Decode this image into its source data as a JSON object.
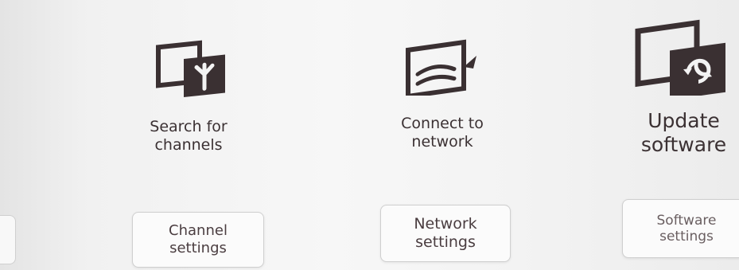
{
  "menu": {
    "items": [
      {
        "title_line1": "Search for",
        "title_line2": "channels",
        "icon": "antenna-screen-icon",
        "button_line1": "Channel",
        "button_line2": "settings"
      },
      {
        "title_line1": "Connect to",
        "title_line2": "network",
        "icon": "network-screen-icon",
        "button_line1": "Network",
        "button_line2": "settings"
      },
      {
        "title_line1": "Update",
        "title_line2": "software",
        "icon": "update-screen-icon",
        "button_line1": "Software",
        "button_line2": "settings"
      }
    ]
  },
  "colors": {
    "icon_dark": "#3a3032",
    "text": "#3b3133",
    "button_border": "#cfcfcf"
  }
}
